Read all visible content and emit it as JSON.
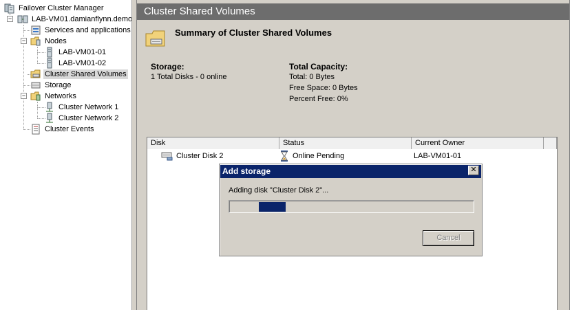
{
  "tree": {
    "root": "Failover Cluster Manager",
    "cluster": "LAB-VM01.damianflynn.demo",
    "services": "Services and applications",
    "nodes": "Nodes",
    "node1": "LAB-VM01-01",
    "node2": "LAB-VM01-02",
    "csv": "Cluster Shared Volumes",
    "storage": "Storage",
    "networks": "Networks",
    "net1": "Cluster Network 1",
    "net2": "Cluster Network 2",
    "events": "Cluster Events",
    "expand_minus": "−"
  },
  "main": {
    "header": "Cluster Shared Volumes",
    "summary_title": "Summary of Cluster Shared Volumes",
    "storage_label": "Storage:",
    "storage_value": "1 Total Disks - 0 online",
    "capacity_label": "Total Capacity:",
    "capacity_total": "Total: 0 Bytes",
    "capacity_free": "Free Space: 0 Bytes",
    "capacity_percent": "Percent Free: 0%"
  },
  "table": {
    "columns": [
      "Disk",
      "Status",
      "Current Owner"
    ],
    "rows": [
      {
        "disk": "Cluster Disk 2",
        "status": "Online Pending",
        "owner": "LAB-VM01-01"
      }
    ]
  },
  "dialog": {
    "title": "Add storage",
    "close_glyph": "✕",
    "message": "Adding disk \"Cluster Disk 2\"...",
    "progress_start": 0.12,
    "progress_end": 0.23,
    "cancel_label": "Cancel"
  },
  "colors": {
    "title_bar": "#0a246a",
    "header_bar": "#6d6d6d",
    "selection": "#d9d9d9"
  }
}
